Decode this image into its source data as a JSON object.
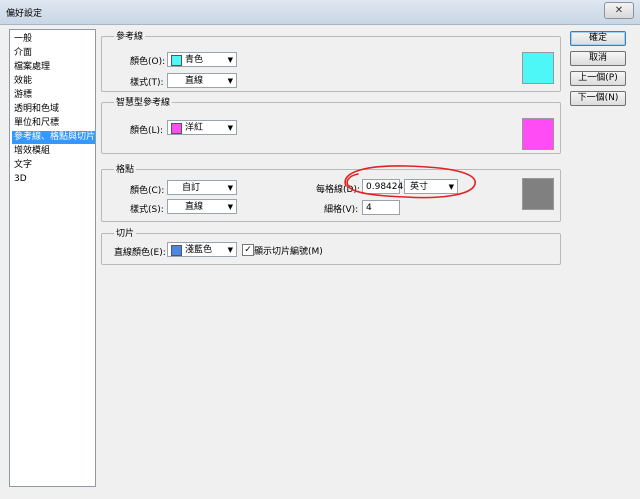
{
  "window": {
    "title": "偏好設定",
    "close_label": "✕"
  },
  "sidebar": {
    "items": [
      {
        "label": "一般",
        "selected": false
      },
      {
        "label": "介面",
        "selected": false
      },
      {
        "label": "檔案處理",
        "selected": false
      },
      {
        "label": "效能",
        "selected": false
      },
      {
        "label": "游標",
        "selected": false
      },
      {
        "label": "透明和色域",
        "selected": false
      },
      {
        "label": "單位和尺標",
        "selected": false
      },
      {
        "label": "參考線、格點與切片",
        "selected": true
      },
      {
        "label": "增效模組",
        "selected": false
      },
      {
        "label": "文字",
        "selected": false
      },
      {
        "label": "3D",
        "selected": false
      }
    ]
  },
  "guides": {
    "title": "參考線",
    "color_label": "顏色(O):",
    "color_value": "青色",
    "color_hex": "#4df7f7",
    "style_label": "樣式(T):",
    "style_value": "直線"
  },
  "smart_guides": {
    "title": "智慧型參考線",
    "color_label": "顏色(L):",
    "color_value": "洋紅",
    "color_hex": "#ff4cf5"
  },
  "grid": {
    "title": "格點",
    "color_label": "顏色(C):",
    "color_value": "自訂",
    "color_hex": "#808080",
    "style_label": "樣式(S):",
    "style_value": "直線",
    "gridline_label": "每格線(D):",
    "gridline_value": "0.98424",
    "unit_value": "英寸",
    "subdiv_label": "細格(V):",
    "subdiv_value": "4"
  },
  "slices": {
    "title": "切片",
    "color_label": "直線顏色(E):",
    "color_value": "淺藍色",
    "color_hex": "#4a86e8",
    "show_numbers_label": "顯示切片編號(M)",
    "show_numbers_checked": "✓"
  },
  "buttons": {
    "ok": "確定",
    "cancel": "取消",
    "prev": "上一個(P)",
    "next": "下一個(N)"
  },
  "colors": {
    "annotation": "#e32222",
    "selection": "#3399ff"
  }
}
